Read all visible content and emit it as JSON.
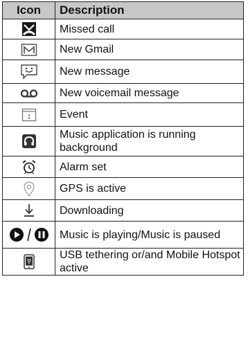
{
  "table": {
    "headers": {
      "icon": "Icon",
      "description": "Description"
    },
    "rows": [
      {
        "icon": "missed-call-icon",
        "description": "Missed call"
      },
      {
        "icon": "gmail-icon",
        "description": "New Gmail"
      },
      {
        "icon": "message-icon",
        "description": "New message"
      },
      {
        "icon": "voicemail-icon",
        "description": "New voicemail message"
      },
      {
        "icon": "calendar-event-icon",
        "description": "Event"
      },
      {
        "icon": "headphones-icon",
        "description": "Music application is running background"
      },
      {
        "icon": "alarm-icon",
        "description": "Alarm set"
      },
      {
        "icon": "gps-pin-icon",
        "description": "GPS is active"
      },
      {
        "icon": "download-icon",
        "description": "Downloading"
      },
      {
        "icon": "play-pause-icon",
        "description": "Music is playing/Music is paused"
      },
      {
        "icon": "hotspot-icon",
        "description": "USB tethering or/and Mobile Hotspot active"
      }
    ]
  }
}
